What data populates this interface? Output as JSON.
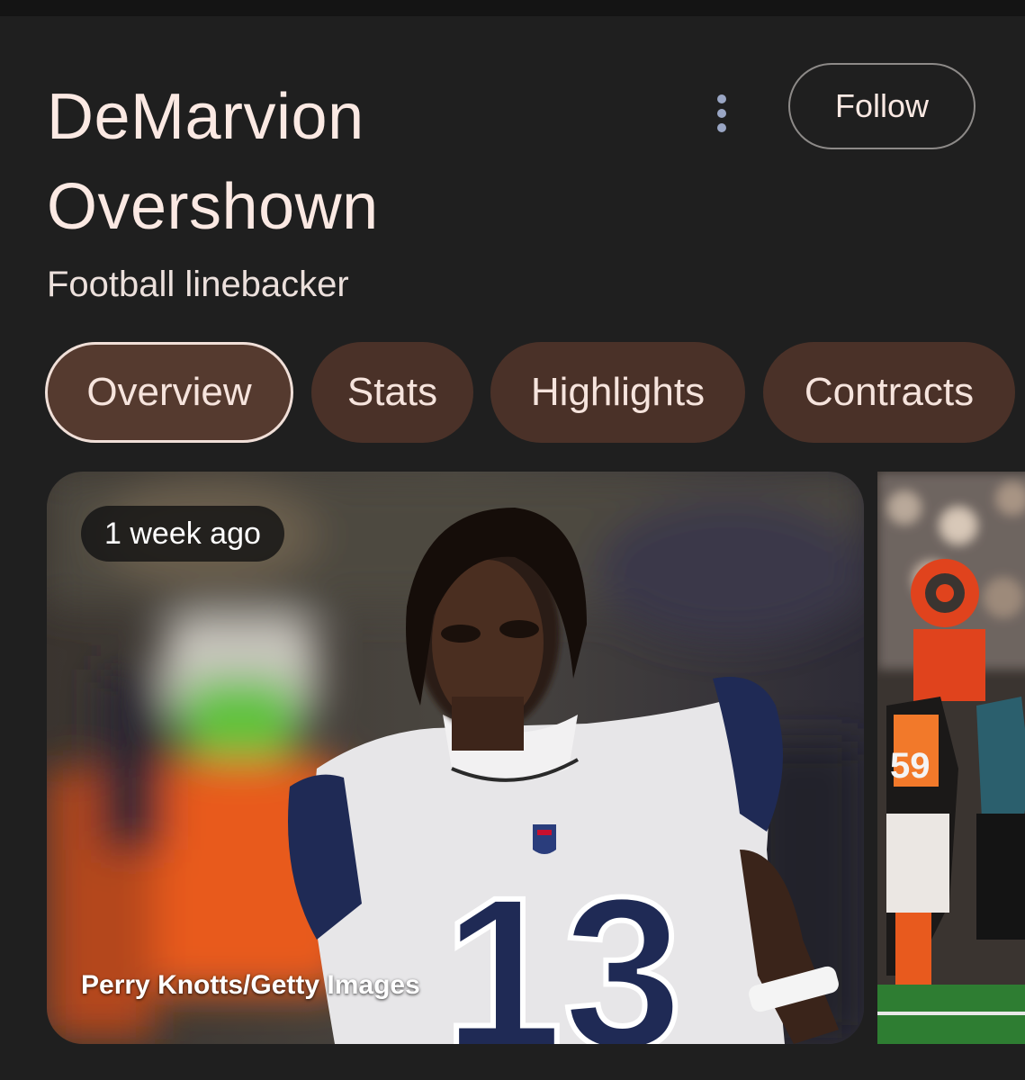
{
  "header": {
    "title_line1": "DeMarvion",
    "title_line2": "Overshown",
    "subtitle": "Football linebacker",
    "follow_label": "Follow",
    "more_icon": "more-vert-icon"
  },
  "tabs": [
    {
      "label": "Overview",
      "selected": true
    },
    {
      "label": "Stats",
      "selected": false
    },
    {
      "label": "Highlights",
      "selected": false
    },
    {
      "label": "Contracts",
      "selected": false
    }
  ],
  "media": {
    "main_card": {
      "timestamp": "1 week ago",
      "credit": "Perry Knotts/Getty Images",
      "jersey_number": "13",
      "image": "player-portrait"
    },
    "side_card": {
      "jersey_number": "59",
      "image": "game-action-photo"
    }
  },
  "colors": {
    "background": "#1f1f1f",
    "chip_background": "#4a3128",
    "text": "#fbe9e3"
  }
}
